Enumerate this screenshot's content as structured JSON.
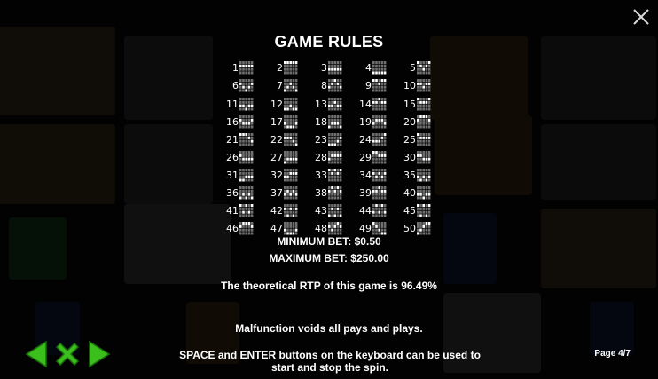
{
  "title": "GAME RULES",
  "paylines": [
    {
      "n": "1",
      "rows": [
        1,
        1,
        1,
        1,
        1
      ]
    },
    {
      "n": "2",
      "rows": [
        0,
        0,
        0,
        0,
        0
      ]
    },
    {
      "n": "3",
      "rows": [
        2,
        2,
        2,
        2,
        2
      ]
    },
    {
      "n": "4",
      "rows": [
        3,
        3,
        3,
        3,
        3
      ]
    },
    {
      "n": "5",
      "rows": [
        0,
        1,
        2,
        1,
        0
      ]
    },
    {
      "n": "6",
      "rows": [
        1,
        2,
        3,
        2,
        1
      ]
    },
    {
      "n": "7",
      "rows": [
        3,
        2,
        1,
        2,
        3
      ]
    },
    {
      "n": "8",
      "rows": [
        2,
        1,
        0,
        1,
        2
      ]
    },
    {
      "n": "9",
      "rows": [
        0,
        0,
        1,
        0,
        0
      ]
    },
    {
      "n": "10",
      "rows": [
        1,
        1,
        2,
        1,
        1
      ]
    },
    {
      "n": "11",
      "rows": [
        2,
        2,
        3,
        2,
        2
      ]
    },
    {
      "n": "12",
      "rows": [
        3,
        3,
        2,
        3,
        3
      ]
    },
    {
      "n": "13",
      "rows": [
        2,
        2,
        1,
        2,
        2
      ]
    },
    {
      "n": "14",
      "rows": [
        1,
        1,
        0,
        1,
        1
      ]
    },
    {
      "n": "15",
      "rows": [
        0,
        1,
        1,
        1,
        0
      ]
    },
    {
      "n": "16",
      "rows": [
        1,
        2,
        2,
        2,
        1
      ]
    },
    {
      "n": "17",
      "rows": [
        2,
        3,
        3,
        3,
        2
      ]
    },
    {
      "n": "18",
      "rows": [
        3,
        2,
        2,
        2,
        3
      ]
    },
    {
      "n": "19",
      "rows": [
        2,
        1,
        1,
        1,
        2
      ]
    },
    {
      "n": "20",
      "rows": [
        1,
        0,
        0,
        0,
        1
      ]
    },
    {
      "n": "21",
      "rows": [
        0,
        0,
        0,
        1,
        2
      ]
    },
    {
      "n": "22",
      "rows": [
        1,
        1,
        1,
        2,
        3
      ]
    },
    {
      "n": "23",
      "rows": [
        3,
        3,
        3,
        2,
        1
      ]
    },
    {
      "n": "24",
      "rows": [
        2,
        2,
        2,
        1,
        0
      ]
    },
    {
      "n": "25",
      "rows": [
        0,
        1,
        1,
        1,
        1
      ]
    },
    {
      "n": "26",
      "rows": [
        1,
        2,
        2,
        2,
        2
      ]
    },
    {
      "n": "27",
      "rows": [
        3,
        2,
        2,
        2,
        2
      ]
    },
    {
      "n": "28",
      "rows": [
        2,
        1,
        1,
        1,
        1
      ]
    },
    {
      "n": "29",
      "rows": [
        0,
        0,
        1,
        1,
        1
      ]
    },
    {
      "n": "30",
      "rows": [
        1,
        1,
        2,
        2,
        2
      ]
    },
    {
      "n": "31",
      "rows": [
        3,
        3,
        2,
        2,
        2
      ]
    },
    {
      "n": "32",
      "rows": [
        2,
        2,
        1,
        1,
        1
      ]
    },
    {
      "n": "33",
      "rows": [
        0,
        1,
        0,
        1,
        0
      ]
    },
    {
      "n": "34",
      "rows": [
        1,
        2,
        1,
        2,
        1
      ]
    },
    {
      "n": "35",
      "rows": [
        2,
        3,
        2,
        3,
        2
      ]
    },
    {
      "n": "36",
      "rows": [
        3,
        2,
        3,
        2,
        3
      ]
    },
    {
      "n": "37",
      "rows": [
        2,
        1,
        2,
        1,
        2
      ]
    },
    {
      "n": "38",
      "rows": [
        1,
        0,
        1,
        0,
        1
      ]
    },
    {
      "n": "39",
      "rows": [
        1,
        1,
        0,
        1,
        1
      ]
    },
    {
      "n": "40",
      "rows": [
        2,
        2,
        3,
        2,
        2
      ]
    },
    {
      "n": "41",
      "rows": [
        0,
        2,
        0,
        2,
        0
      ]
    },
    {
      "n": "42",
      "rows": [
        1,
        3,
        1,
        3,
        1
      ]
    },
    {
      "n": "43",
      "rows": [
        3,
        1,
        3,
        1,
        3
      ]
    },
    {
      "n": "44",
      "rows": [
        2,
        0,
        2,
        0,
        2
      ]
    },
    {
      "n": "45",
      "rows": [
        0,
        3,
        0,
        3,
        0
      ]
    },
    {
      "n": "46",
      "rows": [
        1,
        0,
        0,
        0,
        1
      ]
    },
    {
      "n": "47",
      "rows": [
        2,
        3,
        3,
        3,
        2
      ]
    },
    {
      "n": "48",
      "rows": [
        1,
        2,
        1,
        0,
        1
      ]
    },
    {
      "n": "49",
      "rows": [
        0,
        1,
        2,
        3,
        3
      ]
    },
    {
      "n": "50",
      "rows": [
        3,
        2,
        1,
        0,
        0
      ]
    }
  ],
  "min_bet": "MINIMUM BET: $0.50",
  "max_bet": "MAXIMUM BET: $250.00",
  "rtp": "The theoretical RTP of this game is 96.49%",
  "malfunction": "Malfunction voids all pays and plays.",
  "keys_line1": "SPACE and ENTER buttons on the keyboard can be used to",
  "keys_line2": "start and stop the spin.",
  "page": "Page 4/7",
  "colors": {
    "accent_green": "#3bbf1d",
    "cell_on": "#ffffff",
    "cell_off": "#6f6f6f"
  },
  "icons": {
    "close": "close-icon",
    "prev": "arrow-left-icon",
    "x": "x-icon",
    "next": "arrow-right-icon"
  }
}
